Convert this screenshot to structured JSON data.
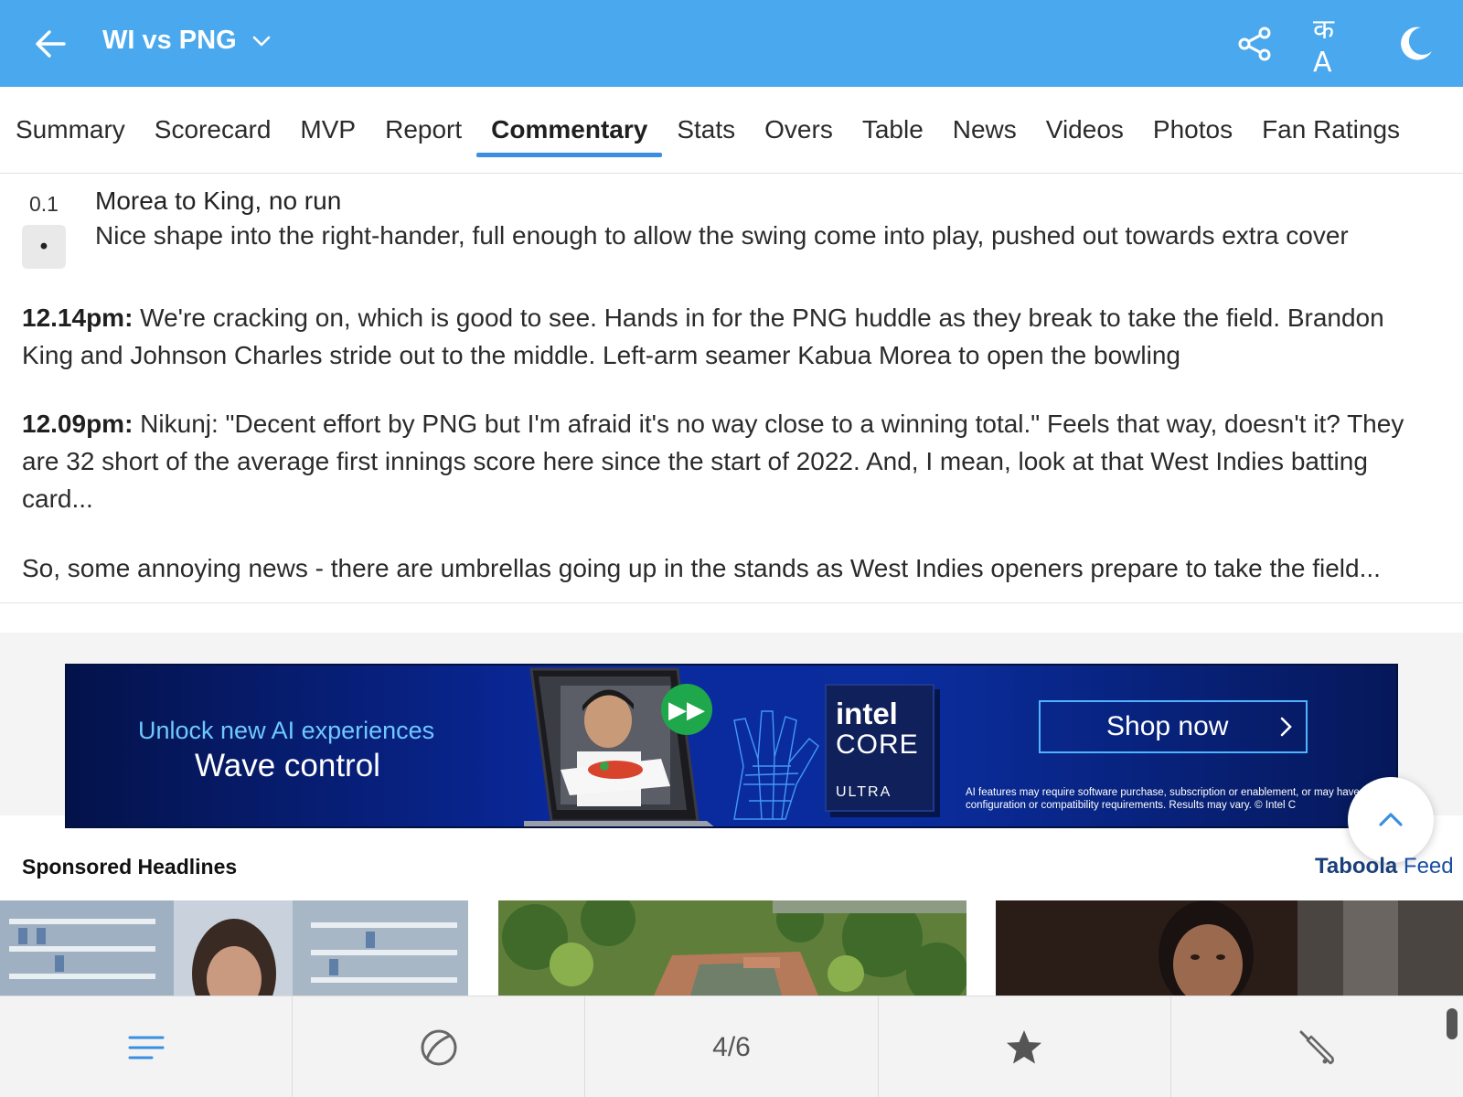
{
  "header": {
    "title": "WI vs PNG",
    "lang_label": "क A",
    "colors": {
      "bar": "#4aa8ee",
      "accent": "#3b8fe0"
    }
  },
  "tabs": [
    {
      "label": "Summary"
    },
    {
      "label": "Scorecard"
    },
    {
      "label": "MVP"
    },
    {
      "label": "Report"
    },
    {
      "label": "Commentary",
      "active": true
    },
    {
      "label": "Stats"
    },
    {
      "label": "Overs"
    },
    {
      "label": "Table"
    },
    {
      "label": "News"
    },
    {
      "label": "Videos"
    },
    {
      "label": "Photos"
    },
    {
      "label": "Fan Ratings"
    }
  ],
  "commentary": {
    "ball": {
      "over": "0.1",
      "result": "•",
      "title": "Morea to King, no run",
      "text": "Nice shape into the right-hander, full enough to allow the swing come into play, pushed out towards extra cover"
    },
    "entries": [
      {
        "time": "12.14pm:",
        "text": " We're cracking on, which is good to see. Hands in for the PNG huddle as they break to take the field. Brandon King and Johnson Charles stride out to the middle. Left-arm seamer Kabua Morea to open the bowling"
      },
      {
        "time": "12.09pm:",
        "text": " Nikunj: \"Decent effort by PNG but I'm afraid it's no way close to a winning total.\" Feels that way, doesn't it? They are 32 short of the average first innings score here since the start of 2022. And, I mean, look at that West Indies batting card..."
      },
      {
        "time": "",
        "text": "So, some annoying news - there are umbrellas going up in the stands as West Indies openers prepare to take the field..."
      }
    ]
  },
  "ad": {
    "line1": "Unlock new AI experiences",
    "line2": "Wave control",
    "brand1": "intel",
    "brand2": "CORE",
    "brand3": "ULTRA",
    "cta": "Shop now",
    "fine_print": "AI features may require software purchase, subscription or enablement, or may have configuration or compatibility requirements. Results may vary. © Intel C"
  },
  "sponsored": {
    "heading": "Sponsored Headlines",
    "provider_brand": "Taboola",
    "provider_suffix": " Feed"
  },
  "bottom_nav": {
    "items": [
      {
        "icon": "menu-icon"
      },
      {
        "icon": "ball-icon"
      },
      {
        "label": "4/6"
      },
      {
        "icon": "star-icon"
      },
      {
        "icon": "bat-icon"
      }
    ]
  }
}
